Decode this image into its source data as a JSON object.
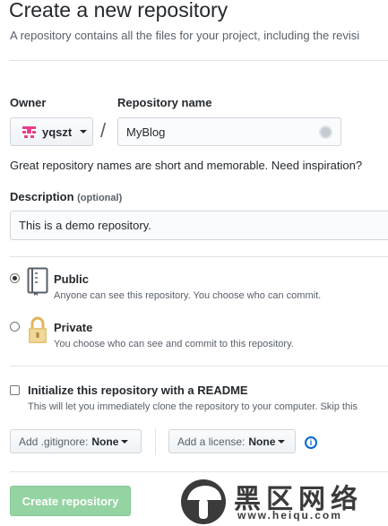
{
  "header": {
    "title": "Create a new repository",
    "subhead": "A repository contains all the files for your project, including the revisi"
  },
  "owner": {
    "label": "Owner",
    "value": "yqszt"
  },
  "repo": {
    "label": "Repository name",
    "value": "MyBlog",
    "separator": "/",
    "hint": "Great repository names are short and memorable. Need inspiration?"
  },
  "description": {
    "label": "Description",
    "optional": "(optional)",
    "value": "This is a demo repository."
  },
  "visibility": {
    "public": {
      "label": "Public",
      "note": "Anyone can see this repository. You choose who can commit.",
      "selected": true
    },
    "private": {
      "label": "Private",
      "note": "You choose who can see and commit to this repository.",
      "selected": false
    }
  },
  "readme": {
    "label": "Initialize this repository with a README",
    "note": "This will let you immediately clone the repository to your computer. Skip this",
    "checked": false
  },
  "gitignore": {
    "prefix": "Add .gitignore:",
    "value": "None"
  },
  "license": {
    "prefix": "Add a license:",
    "value": "None"
  },
  "info_glyph": "i",
  "create_button": "Create repository",
  "watermark": {
    "text": "黑区网络",
    "url": "www.heiqu.com"
  },
  "colors": {
    "accent": "#0366d6",
    "create_button": "#94d3a2"
  }
}
